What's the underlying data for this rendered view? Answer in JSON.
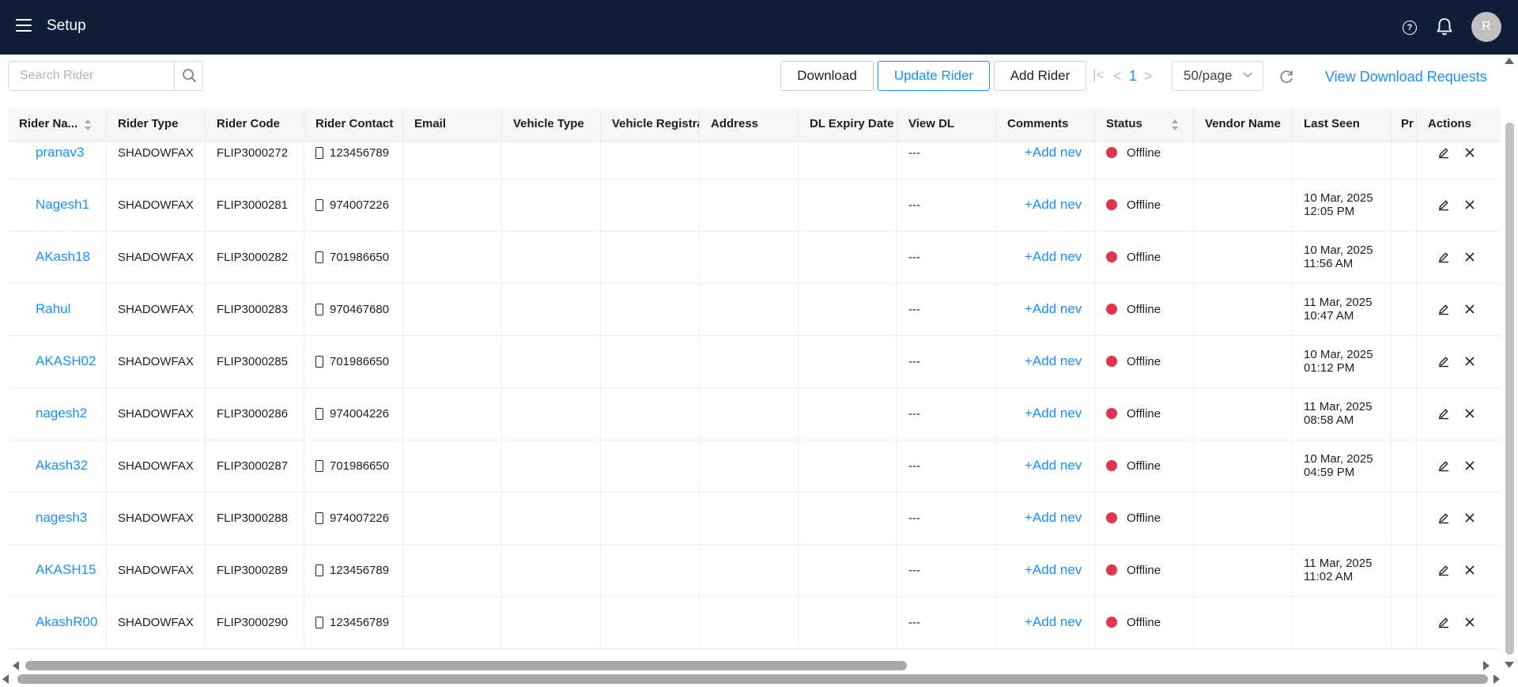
{
  "app": {
    "title": "Setup",
    "avatar_initial": "R",
    "help_glyph": "?"
  },
  "icons": {
    "menu": "hamburger-menu-icon",
    "help": "question-circle-icon",
    "bell": "bell-icon",
    "search": "search-icon",
    "refresh": "refresh-icon",
    "edit": "edit-icon",
    "delete": "close-icon"
  },
  "colors": {
    "header_bg": "#0f1f3a",
    "accent": "#1890ff",
    "status_offline": "#e0364f"
  },
  "toolbar": {
    "search_placeholder": "Search Rider",
    "download_label": "Download",
    "update_label": "Update Rider",
    "add_label": "Add Rider",
    "first_page": "|<",
    "prev_page": "<",
    "current_page": "1",
    "next_page": ">",
    "page_size": "50/page",
    "view_requests_label": "View Download Requests"
  },
  "table": {
    "columns": [
      "Rider Na...",
      "Rider Type",
      "Rider Code",
      "Rider Contact",
      "Email",
      "Vehicle Type",
      "Vehicle Registra",
      "Address",
      "DL Expiry Date",
      "View DL",
      "Comments",
      "Status",
      "Vendor Name",
      "Last Seen",
      "Pr",
      "Actions"
    ],
    "rows": [
      {
        "name": "pranav3",
        "type": "SHADOWFAX",
        "code": "FLIP3000272",
        "contact": "123456789",
        "view_dl": "---",
        "comment": "+Add nev",
        "status": "Offline",
        "last_seen_date": "",
        "last_seen_time": ""
      },
      {
        "name": "Nagesh1",
        "type": "SHADOWFAX",
        "code": "FLIP3000281",
        "contact": "974007226",
        "view_dl": "---",
        "comment": "+Add nev",
        "status": "Offline",
        "last_seen_date": "10 Mar, 2025",
        "last_seen_time": "12:05 PM"
      },
      {
        "name": "AKash18",
        "type": "SHADOWFAX",
        "code": "FLIP3000282",
        "contact": "701986650",
        "view_dl": "---",
        "comment": "+Add nev",
        "status": "Offline",
        "last_seen_date": "10 Mar, 2025",
        "last_seen_time": "11:56 AM"
      },
      {
        "name": "Rahul",
        "type": "SHADOWFAX",
        "code": "FLIP3000283",
        "contact": "970467680",
        "view_dl": "---",
        "comment": "+Add nev",
        "status": "Offline",
        "last_seen_date": "11 Mar, 2025",
        "last_seen_time": "10:47 AM"
      },
      {
        "name": "AKASH02",
        "type": "SHADOWFAX",
        "code": "FLIP3000285",
        "contact": "701986650",
        "view_dl": "---",
        "comment": "+Add nev",
        "status": "Offline",
        "last_seen_date": "10 Mar, 2025",
        "last_seen_time": "01:12 PM"
      },
      {
        "name": "nagesh2",
        "type": "SHADOWFAX",
        "code": "FLIP3000286",
        "contact": "974004226",
        "view_dl": "---",
        "comment": "+Add nev",
        "status": "Offline",
        "last_seen_date": "11 Mar, 2025",
        "last_seen_time": "08:58 AM"
      },
      {
        "name": "Akash32",
        "type": "SHADOWFAX",
        "code": "FLIP3000287",
        "contact": "701986650",
        "view_dl": "---",
        "comment": "+Add nev",
        "status": "Offline",
        "last_seen_date": "10 Mar, 2025",
        "last_seen_time": "04:59 PM"
      },
      {
        "name": "nagesh3",
        "type": "SHADOWFAX",
        "code": "FLIP3000288",
        "contact": "974007226",
        "view_dl": "---",
        "comment": "+Add nev",
        "status": "Offline",
        "last_seen_date": "",
        "last_seen_time": ""
      },
      {
        "name": "AKASH15",
        "type": "SHADOWFAX",
        "code": "FLIP3000289",
        "contact": "123456789",
        "view_dl": "---",
        "comment": "+Add nev",
        "status": "Offline",
        "last_seen_date": "11 Mar, 2025",
        "last_seen_time": "11:02 AM"
      },
      {
        "name": "AkashR00",
        "type": "SHADOWFAX",
        "code": "FLIP3000290",
        "contact": "123456789",
        "view_dl": "---",
        "comment": "+Add nev",
        "status": "Offline",
        "last_seen_date": "",
        "last_seen_time": ""
      }
    ]
  }
}
